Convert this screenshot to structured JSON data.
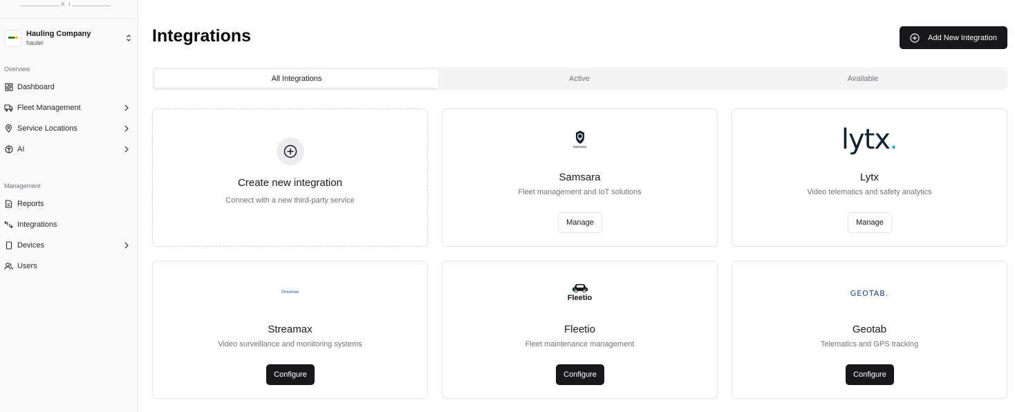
{
  "sidebar": {
    "logo_mark": "A I",
    "company": {
      "name": "Hauling Company",
      "subtitle": "hauler"
    },
    "sections": {
      "overview_label": "Overview",
      "management_label": "Management"
    },
    "items": [
      {
        "label": "Dashboard",
        "icon": "dashboard-icon",
        "has_chevron": false
      },
      {
        "label": "Fleet Management",
        "icon": "truck-icon",
        "has_chevron": true
      },
      {
        "label": "Service Locations",
        "icon": "map-pin-icon",
        "has_chevron": true
      },
      {
        "label": "AI",
        "icon": "ai-icon",
        "has_chevron": true
      },
      {
        "label": "Reports",
        "icon": "file-icon",
        "has_chevron": false
      },
      {
        "label": "Integrations",
        "icon": "integrations-icon",
        "has_chevron": false
      },
      {
        "label": "Devices",
        "icon": "device-icon",
        "has_chevron": true
      },
      {
        "label": "Users",
        "icon": "users-icon",
        "has_chevron": false
      }
    ]
  },
  "header": {
    "title": "Integrations",
    "add_button_label": "Add New Integration"
  },
  "tabs": [
    {
      "label": "All Integrations",
      "active": true
    },
    {
      "label": "Active",
      "active": false
    },
    {
      "label": "Available",
      "active": false
    }
  ],
  "create_card": {
    "title": "Create new integration",
    "description": "Connect with a new third-party service"
  },
  "integrations": [
    {
      "name": "Samsara",
      "description": "Fleet management and IoT solutions",
      "logo_text": "samsara",
      "action": "Manage"
    },
    {
      "name": "Lytx",
      "description": "Video telematics and safety analytics",
      "logo_text": "lytx",
      "action": "Manage"
    },
    {
      "name": "Streamax",
      "description": "Video surveillance and monitoring systems",
      "logo_text": "Streamax",
      "action": "Configure"
    },
    {
      "name": "Fleetio",
      "description": "Fleet maintenance management",
      "logo_text": "Fleetio",
      "action": "Configure"
    },
    {
      "name": "Geotab",
      "description": "Telematics and GPS tracking",
      "logo_text": "GEOTAB.",
      "action": "Configure"
    }
  ],
  "colors": {
    "primary": "#18181b",
    "muted_text": "#71717a",
    "border": "#e4e4e7",
    "tab_bg": "#f4f4f5",
    "sidebar_bg": "#fafafa",
    "lytx_accent": "#2aa6d9",
    "geotab_blue": "#1f3e8e"
  }
}
